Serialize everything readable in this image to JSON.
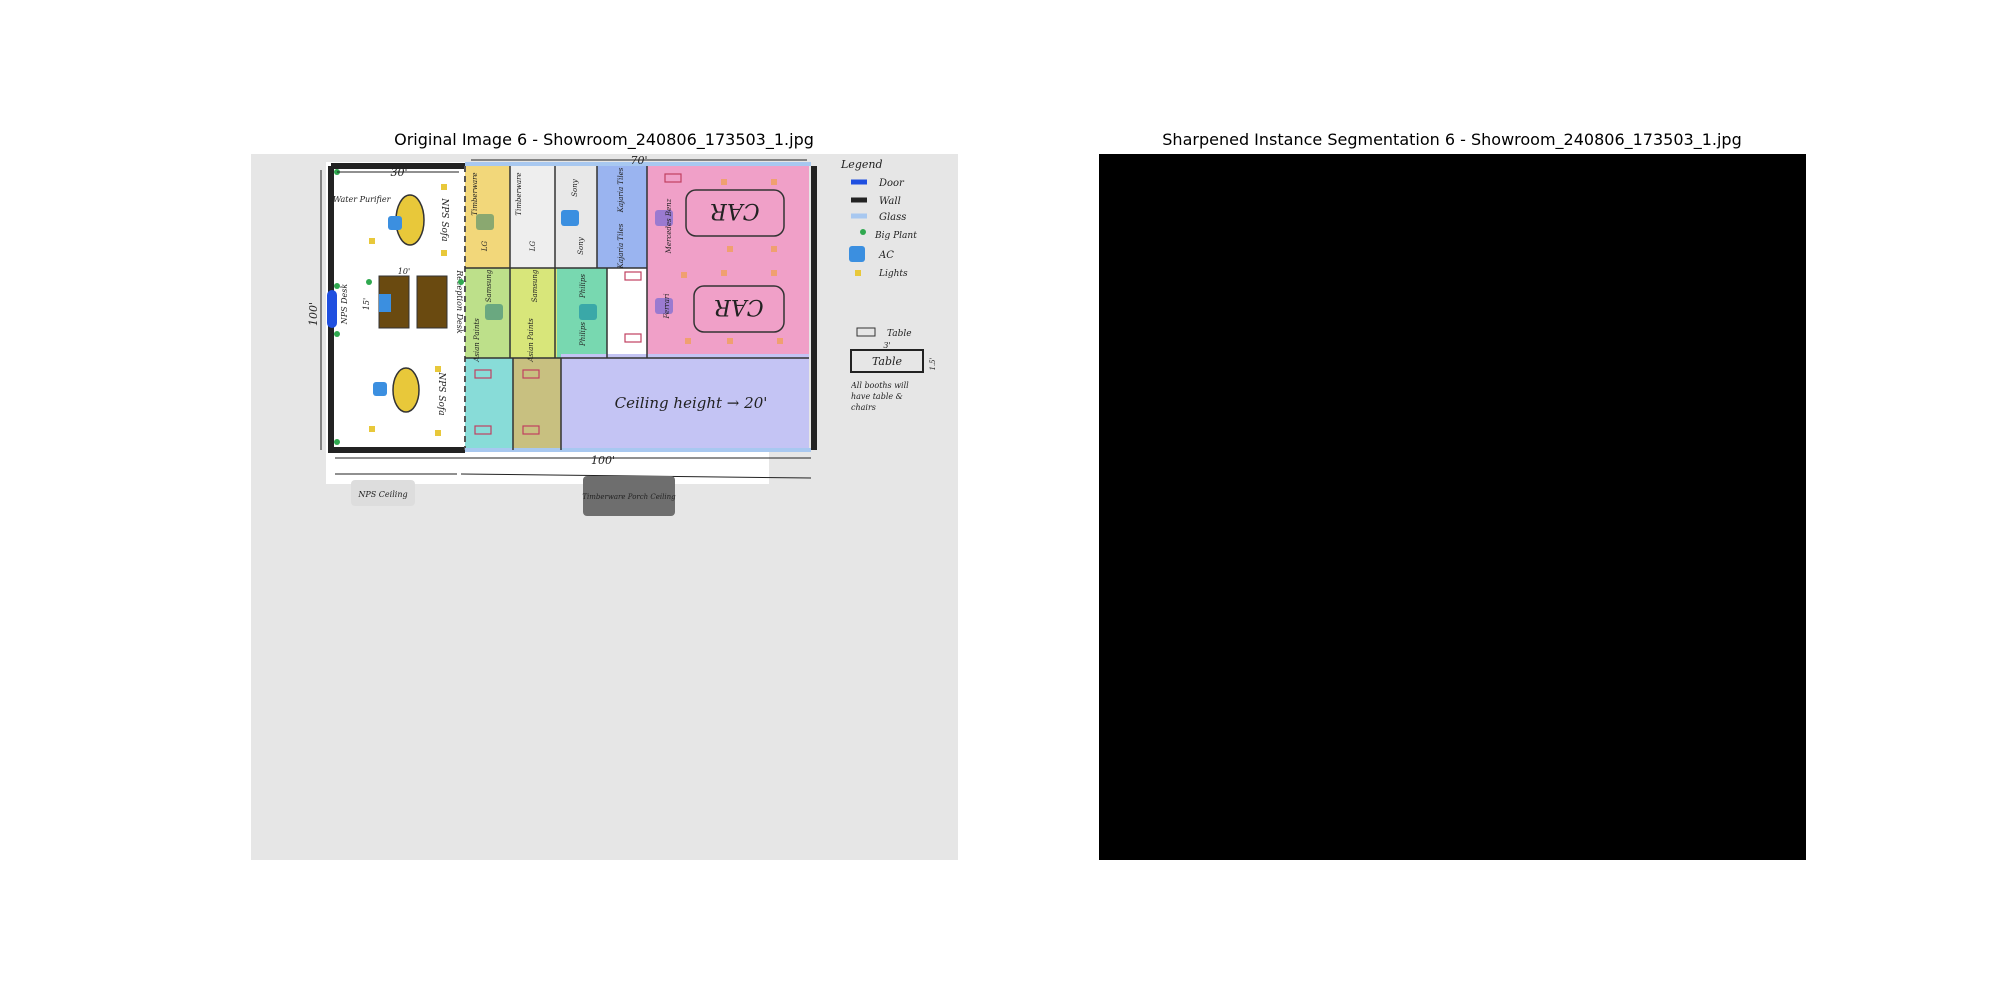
{
  "figure": {
    "left_title": "Original Image 6 - Showroom_240806_173503_1.jpg",
    "right_title": "Sharpened Instance Segmentation 6 - Showroom_240806_173503_1.jpg"
  },
  "plan": {
    "dim_top": "70'",
    "dim_left_top": "30'",
    "dim_height": "100'",
    "dim_bottom": "100'",
    "nps_ceiling": "NPS Ceiling",
    "timberware_ceiling": "Timberware Porch Ceiling",
    "car_1": "CAR",
    "car_2": "CAR",
    "ceiling_note": "Ceiling height → 20'",
    "water_purifier": "Water Purifier",
    "nps_sofa_1": "NPS Sofa",
    "nps_sofa_2": "NPS Sofa",
    "nps_desk": "NPS Desk",
    "reception_desk": "Reception Desk",
    "booth_labels": [
      "Timberware",
      "Timberware",
      "Sony",
      "Kajaria Tiles",
      "Kajaria Tiles",
      "LG",
      "LG",
      "Sony",
      "Samsung",
      "Samsung",
      "Philips",
      "Philips",
      "Asian Paints",
      "Asian Paints",
      "Mercedes Benz",
      "Ferrari"
    ],
    "dim_10": "10'",
    "dim_15": "15'"
  },
  "legend": {
    "title": "Legend",
    "items": [
      {
        "label": "Door",
        "color": "#1f4fe0"
      },
      {
        "label": "Wall",
        "color": "#222222"
      },
      {
        "label": "Glass",
        "color": "#a8c8f0"
      },
      {
        "label": "Big Plant",
        "color": "#2fa84f"
      },
      {
        "label": "AC",
        "color": "#3b8fe0"
      },
      {
        "label": "Lights",
        "color": "#e8c83a"
      }
    ],
    "table_label": "Table",
    "table_box": "Table",
    "table_dim": "3'",
    "table_dim_side": "1.5'",
    "note": "All booths will have table & chairs"
  }
}
